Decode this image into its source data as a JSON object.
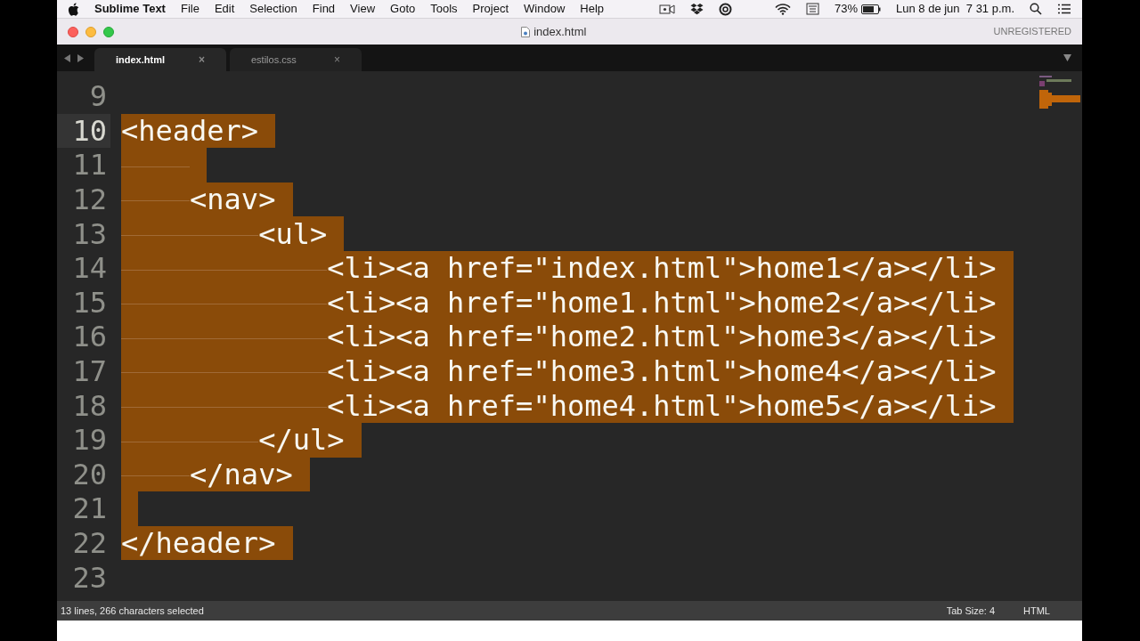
{
  "menu_bar": {
    "app": "Sublime Text",
    "items": [
      "File",
      "Edit",
      "Selection",
      "Find",
      "View",
      "Goto",
      "Tools",
      "Project",
      "Window",
      "Help"
    ],
    "battery": "73%",
    "clock": "Lun 8 de jun  7 31 p.m."
  },
  "window": {
    "title": "index.html",
    "license": "UNREGISTERED"
  },
  "tabs": [
    {
      "label": "index.html",
      "selected": true,
      "close": "×"
    },
    {
      "label": "estilos.css",
      "selected": false,
      "close": "×"
    }
  ],
  "lines": [
    {
      "number": "9",
      "kind": "blank",
      "selected": false,
      "current": false
    },
    {
      "number": "10",
      "text": "<header>",
      "selected": true,
      "current": true
    },
    {
      "number": "11",
      "kind": "indented-blank",
      "selected": true,
      "current": false
    },
    {
      "number": "12",
      "text": "\t<nav>",
      "selected": true,
      "current": false
    },
    {
      "number": "13",
      "text": "\t\t<ul>",
      "selected": true,
      "current": false
    },
    {
      "number": "14",
      "text": "\t\t\t<li><a href=\"index.html\">home1</a></li>",
      "selected": true,
      "current": false
    },
    {
      "number": "15",
      "text": "\t\t\t<li><a href=\"home1.html\">home2</a></li>",
      "selected": true,
      "current": false
    },
    {
      "number": "16",
      "text": "\t\t\t<li><a href=\"home2.html\">home3</a></li>",
      "selected": true,
      "current": false
    },
    {
      "number": "17",
      "text": "\t\t\t<li><a href=\"home3.html\">home4</a></li>",
      "selected": true,
      "current": false
    },
    {
      "number": "18",
      "text": "\t\t\t<li><a href=\"home4.html\">home5</a></li>",
      "selected": true,
      "current": false
    },
    {
      "number": "19",
      "text": "\t\t</ul>",
      "selected": true,
      "current": false
    },
    {
      "number": "20",
      "text": "\t</nav>",
      "selected": true,
      "current": false
    },
    {
      "number": "21",
      "kind": "blank",
      "selected": true,
      "current": false
    },
    {
      "number": "22",
      "text": "</header>",
      "selected": true,
      "current": false
    },
    {
      "number": "23",
      "kind": "blank",
      "selected": false,
      "current": false
    }
  ],
  "status_bar": {
    "selection": "13 lines, 266 characters selected",
    "tab_size": "Tab Size: 4",
    "syntax": "HTML"
  }
}
